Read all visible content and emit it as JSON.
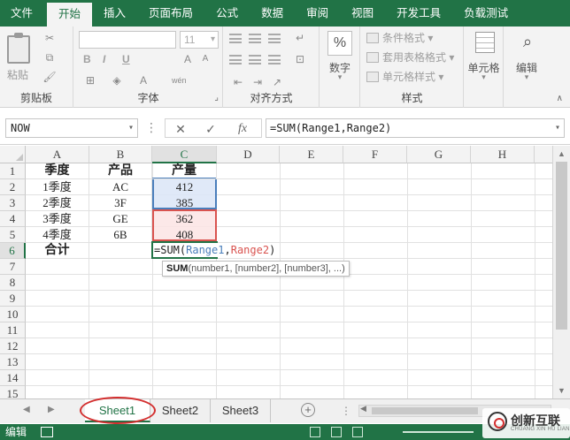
{
  "ribbon_tabs": [
    "文件",
    "开始",
    "插入",
    "页面布局",
    "公式",
    "数据",
    "审阅",
    "视图",
    "开发工具",
    "负载测试"
  ],
  "active_tab": "开始",
  "ribbon": {
    "clipboard": {
      "paste": "粘贴",
      "label": "剪贴板"
    },
    "font": {
      "font_name": "",
      "font_size": "11",
      "bold": "B",
      "italic": "I",
      "underline": "U",
      "label": "字体"
    },
    "alignment": {
      "label": "对齐方式"
    },
    "number": {
      "symbol": "%",
      "button": "数字"
    },
    "styles": {
      "conditional": "条件格式",
      "table": "套用表格格式",
      "cell_style": "单元格样式",
      "label": "样式"
    },
    "cells": {
      "button": "单元格"
    },
    "editing": {
      "button": "编辑"
    }
  },
  "formula_bar": {
    "name_box": "NOW",
    "cancel_icon": "✕",
    "enter_icon": "✓",
    "fx_icon": "fx",
    "formula": "=SUM(Range1,Range2)"
  },
  "columns": [
    "A",
    "B",
    "C",
    "D",
    "E",
    "F",
    "G",
    "H"
  ],
  "rows": [
    "1",
    "2",
    "3",
    "4",
    "5",
    "6",
    "7",
    "8",
    "9",
    "10",
    "11",
    "12",
    "13",
    "14",
    "15"
  ],
  "table": {
    "headers": [
      "季度",
      "产品",
      "产量"
    ],
    "data": [
      [
        "1季度",
        "AC",
        "412"
      ],
      [
        "2季度",
        "3F",
        "385"
      ],
      [
        "3季度",
        "GE",
        "362"
      ],
      [
        "4季度",
        "6B",
        "408"
      ]
    ],
    "total_label": "合计"
  },
  "active_cell": {
    "prefix": "=SUM(",
    "ref1": "Range1",
    "sep": ",",
    "ref2": "Range2",
    "suffix": ")"
  },
  "tooltip": {
    "fn": "SUM",
    "args": "(number1, [number2], [number3], ...)"
  },
  "sheets": [
    "Sheet1",
    "Sheet2",
    "Sheet3"
  ],
  "active_sheet": "Sheet1",
  "status": {
    "mode": "编辑"
  },
  "watermark": {
    "title": "创新互联",
    "subtitle": "CHUANG XIN HU LIAN"
  },
  "colors": {
    "excel_green": "#217346",
    "range1": "#4a7ebb",
    "range2": "#d9534f"
  }
}
